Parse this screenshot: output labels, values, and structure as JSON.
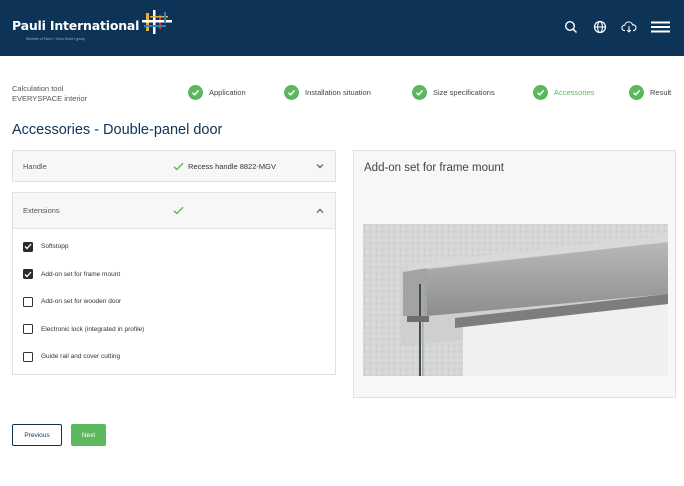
{
  "brand": {
    "name": "Pauli International",
    "tagline": "Member of Pauli + Sohn GmbH group",
    "colors": {
      "header": "#0d3457",
      "accent": "#5cb85c"
    }
  },
  "header_icons": [
    "search-icon",
    "globe-icon",
    "cloud-download-icon",
    "menu-icon"
  ],
  "tool": {
    "line1": "Calculation tool",
    "line2": "EVERYSPACE interior"
  },
  "steps": [
    {
      "label": "Application",
      "done": true
    },
    {
      "label": "Installation situation",
      "done": true
    },
    {
      "label": "Size specifications",
      "done": true
    },
    {
      "label": "Accessories",
      "done": true,
      "active": true
    },
    {
      "label": "Result",
      "done": true
    }
  ],
  "title": "Accessories - Double-panel door",
  "handle": {
    "label": "Handle",
    "value": "Recess handle 8822-MGV"
  },
  "extensions": {
    "label": "Extensions",
    "options": [
      {
        "label": "Softstopp",
        "checked": true
      },
      {
        "label": "Add-on set for frame mount",
        "checked": true
      },
      {
        "label": "Add-on set for wooden door",
        "checked": false
      },
      {
        "label": "Electronic lock (integrated in profile)",
        "checked": false
      },
      {
        "label": "Guide rail and cover cutting",
        "checked": false
      }
    ]
  },
  "preview": {
    "title": "Add-on set for frame mount"
  },
  "nav": {
    "previous": "Previous",
    "next": "Next"
  }
}
